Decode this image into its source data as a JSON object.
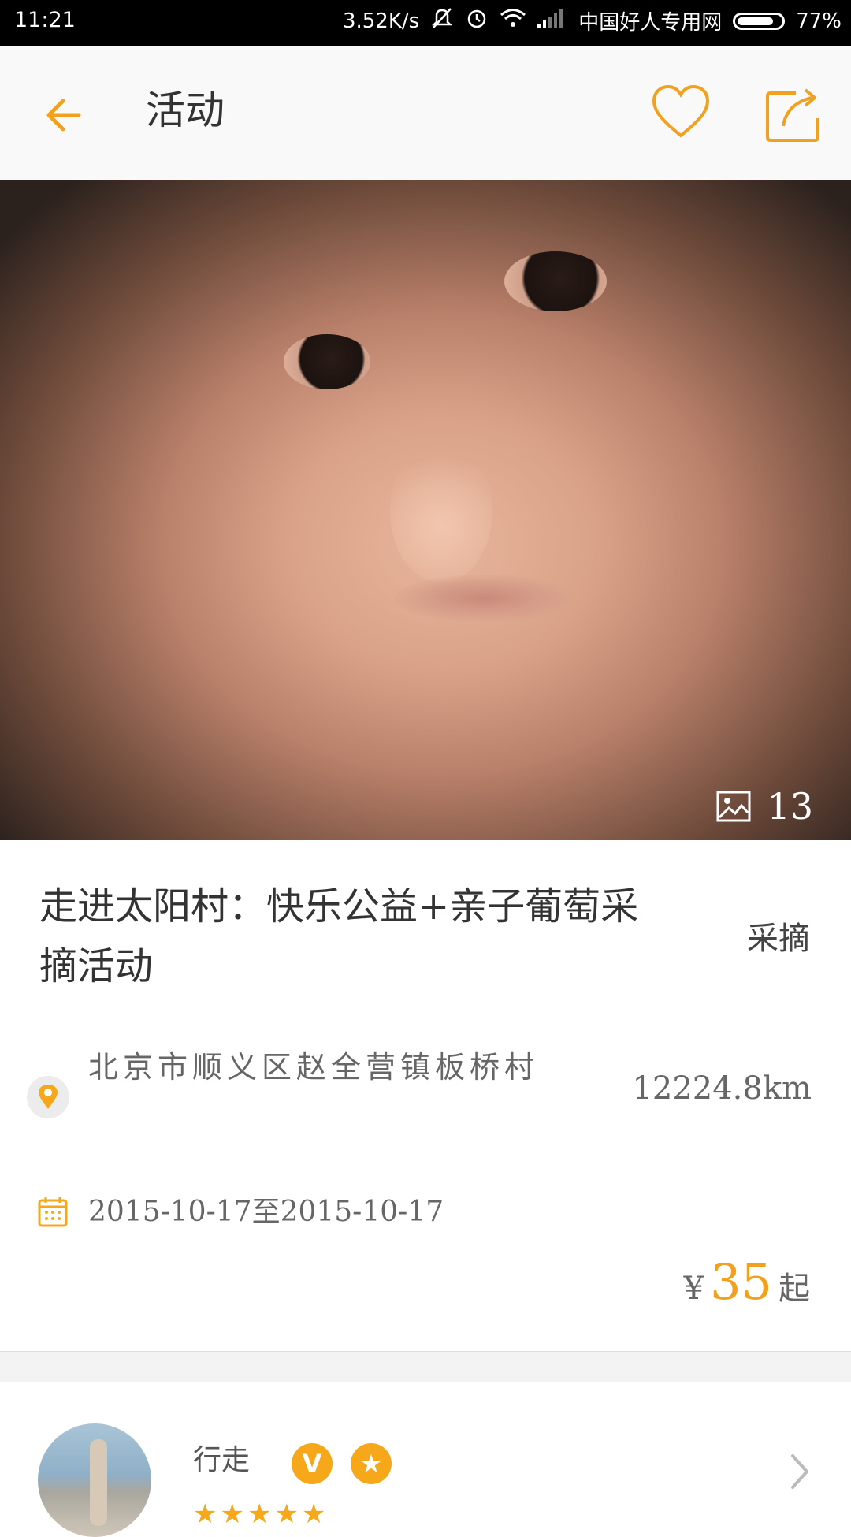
{
  "status_bar": {
    "time": "11:21",
    "network_speed": "3.52K/s",
    "carrier": "中国好人专用网",
    "battery": "77%"
  },
  "app_bar": {
    "title": "活动",
    "back_icon": "arrow-left-icon",
    "favorite_icon": "heart-icon",
    "share_icon": "share-icon",
    "accent_color": "#f2a11f"
  },
  "hero": {
    "image_count": "13"
  },
  "event": {
    "title": "走进太阳村：快乐公益+亲子葡萄采摘活动",
    "tag": "采摘",
    "address": "北京市顺义区赵全营镇板桥村",
    "distance": "12224.8km",
    "dates": "2015-10-17至2015-10-17",
    "currency": "¥",
    "price": "35",
    "price_suffix": "起"
  },
  "organizer": {
    "name": "行走",
    "badge_v": "V",
    "badge_star": "★",
    "rating": "★★★★★"
  }
}
